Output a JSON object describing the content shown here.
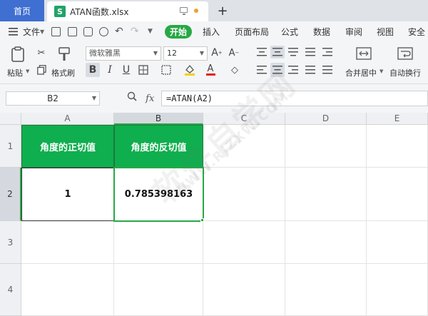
{
  "tabs": {
    "home": "首页",
    "file_icon": "S",
    "file_name": "ATAN函数.xlsx",
    "new_tab": "+"
  },
  "menu": {
    "file": "文件",
    "items": [
      "开始",
      "插入",
      "页面布局",
      "公式",
      "数据",
      "审阅",
      "视图",
      "安全"
    ]
  },
  "ribbon": {
    "paste": "粘贴",
    "format_painter": "格式刷",
    "font_name": "微软雅黑",
    "font_size": "12",
    "merge_center": "合并居中",
    "wrap_text": "自动换行"
  },
  "formula_bar": {
    "name_box": "B2",
    "fx": "fx",
    "formula": "=ATAN(A2)"
  },
  "sheet": {
    "columns": [
      "A",
      "B",
      "C",
      "D",
      "E"
    ],
    "rows": [
      "1",
      "2",
      "3",
      "4"
    ],
    "cells": {
      "A1": "角度的正切值",
      "B1": "角度的反切值",
      "A2": "1",
      "B2": "0.785398163"
    }
  },
  "watermark": {
    "main": "软件自学网",
    "sub": "WWW.RJZXW.COM"
  },
  "colors": {
    "accent": "#27a845",
    "header_fill": "#0fae4e",
    "home_tab": "#3f6fd1"
  }
}
